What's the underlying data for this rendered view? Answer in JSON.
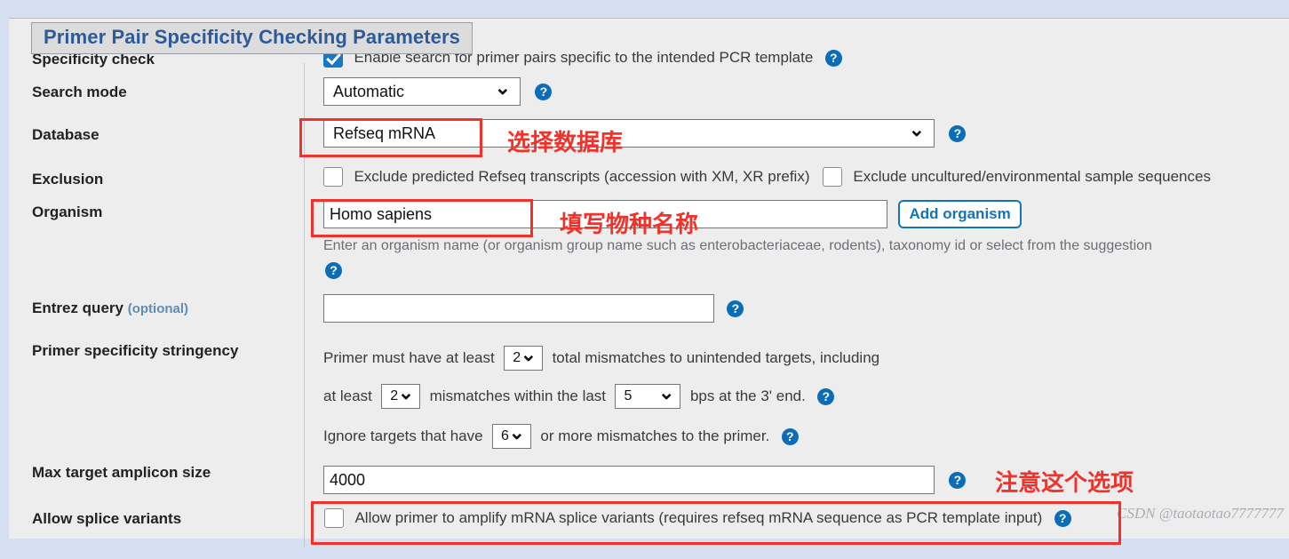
{
  "panel": {
    "title": "Primer Pair Specificity Checking Parameters"
  },
  "rows": {
    "specificity_check": {
      "label": "Specificity check",
      "checkbox_label": "Enable search for primer pairs specific to the intended PCR template",
      "checked": true
    },
    "search_mode": {
      "label": "Search mode",
      "value": "Automatic"
    },
    "database": {
      "label": "Database",
      "value": "Refseq mRNA"
    },
    "exclusion": {
      "label": "Exclusion",
      "option1": "Exclude predicted Refseq transcripts (accession with XM, XR prefix)",
      "option2": "Exclude uncultured/environmental sample sequences"
    },
    "organism": {
      "label": "Organism",
      "value": "Homo sapiens",
      "add_button": "Add organism",
      "hint": "Enter an organism name (or organism group name such as enterobacteriaceae, rodents), taxonomy id or select from the suggestion"
    },
    "entrez_query": {
      "label": "Entrez query",
      "label_optional": "(optional)",
      "value": "",
      "placeholder": ""
    },
    "stringency": {
      "label": "Primer specificity stringency",
      "line1_before": "Primer must have at least",
      "line1_value": "2",
      "line1_after": "total mismatches to unintended targets, including",
      "line2_before": "at least",
      "line2_value": "2",
      "line2_mid": "mismatches within the last",
      "line2_value2": "5",
      "line2_after": "bps at the 3' end.",
      "line3_before": "Ignore targets that have",
      "line3_value": "6",
      "line3_after": "or more mismatches to the primer."
    },
    "max_amplicon": {
      "label": "Max target amplicon size",
      "value": "4000"
    },
    "splice_variants": {
      "label": "Allow splice variants",
      "checkbox_label": "Allow primer to amplify mRNA splice variants (requires refseq mRNA sequence as PCR template input)",
      "checked": false
    }
  },
  "annotations": {
    "database_note": "选择数据库",
    "organism_note": "填写物种名称",
    "splice_note": "注意这个选项"
  },
  "watermark": "CSDN @taotaotao7777777",
  "icons": {
    "help": "?",
    "chevron": "❯"
  },
  "colors": {
    "accent": "#1275bc",
    "annotation": "#f0322b",
    "legend_text": "#2d5b9a"
  }
}
